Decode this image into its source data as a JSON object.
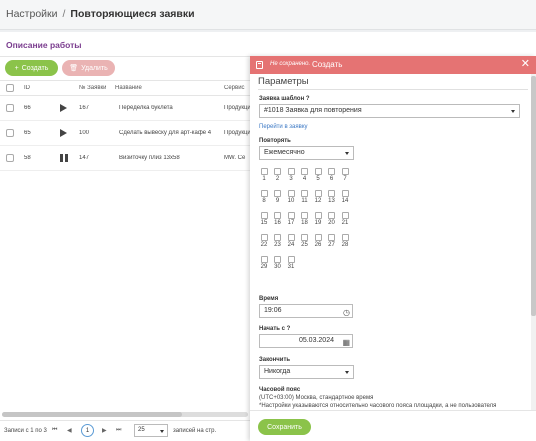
{
  "breadcrumb": {
    "parent": "Настройки",
    "separator": "/",
    "current": "Повторяющиеся заявки"
  },
  "section": {
    "title": "Описание работы"
  },
  "toolbar": {
    "create_label": "Создать",
    "delete_label": "Удалить",
    "create_icon": "+",
    "delete_icon": "🗑"
  },
  "table": {
    "headers": {
      "id": "ID",
      "req_no": "№ Заявки",
      "name": "Название",
      "service": "Сервис"
    },
    "rows": [
      {
        "id": "66",
        "state": "play",
        "req_no": "167",
        "name": "Переделка буклета",
        "service": "Продукция"
      },
      {
        "id": "65",
        "state": "play",
        "req_no": "100",
        "name": "Сделать вывеску для арт-кафе 4",
        "service": "Продукция"
      },
      {
        "id": "58",
        "state": "pause",
        "req_no": "147",
        "name": "Визиточку плиз 13х58",
        "service": "MW. Се"
      }
    ]
  },
  "pager": {
    "info": "Записи с 1 по 3",
    "first": "⏮",
    "prev": "◀",
    "current": "1",
    "next": "▶",
    "last": "⏭",
    "per_page": "25",
    "per_page_label": "записей на стр."
  },
  "panel": {
    "status": "Не сохранено.",
    "title": "Создать",
    "close": "✕",
    "params_title": "Параметры",
    "template_label": "Заявка шаблон",
    "template_help": "?",
    "template_value": "#1018 Заявка для повторения",
    "goto_link": "Перейти в заявку",
    "repeat_label": "Повторять",
    "repeat_value": "Ежемесячно",
    "days": [
      "1",
      "2",
      "3",
      "4",
      "5",
      "6",
      "7",
      "8",
      "9",
      "10",
      "11",
      "12",
      "13",
      "14",
      "15",
      "16",
      "17",
      "18",
      "19",
      "20",
      "21",
      "22",
      "23",
      "24",
      "25",
      "26",
      "27",
      "28",
      "29",
      "30",
      "31"
    ],
    "time_label": "Время",
    "time_value": "19:06",
    "start_label": "Начать с",
    "start_help": "?",
    "start_value": "05.03.2024",
    "end_label": "Закончить",
    "end_value": "Никогда",
    "tz_label": "Часовой пояс",
    "tz_value": "(UTC+03:00) Москва, стандартное время",
    "tz_note": "*Настройки указываются относительно часового пояса площадки, а не пользователя",
    "save_label": "Сохранить"
  },
  "colors": {
    "accent_green": "#8bc34a",
    "header_red": "#e57373",
    "title_purple": "#7a3c8e",
    "link_blue": "#3b78c4"
  },
  "icons": {
    "clock": "clock-icon",
    "calendar": "calendar-icon",
    "close": "close-icon",
    "document": "document-icon"
  }
}
